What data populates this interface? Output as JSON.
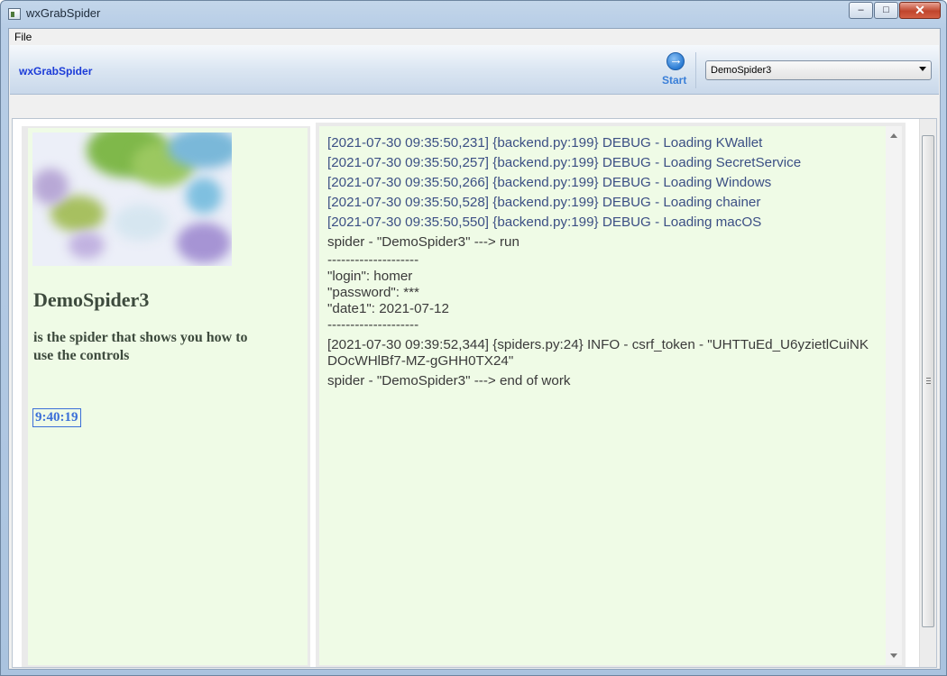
{
  "window": {
    "title": "wxGrabSpider"
  },
  "menu": {
    "file": "File"
  },
  "toolbar": {
    "brand": "wxGrabSpider",
    "start_label": "Start",
    "spider_selected": "DemoSpider3"
  },
  "spider": {
    "name": "DemoSpider3",
    "description": "is the spider that shows you how to use the controls",
    "clock": "9:40:19"
  },
  "log": {
    "lines": [
      "[2021-07-30 09:35:50,231] {backend.py:199} DEBUG - Loading KWallet",
      "[2021-07-30 09:35:50,257] {backend.py:199} DEBUG - Loading SecretService",
      "[2021-07-30 09:35:50,266] {backend.py:199} DEBUG - Loading Windows",
      "[2021-07-30 09:35:50,528] {backend.py:199} DEBUG - Loading chainer",
      "[2021-07-30 09:35:50,550] {backend.py:199} DEBUG - Loading macOS",
      "spider - \"DemoSpider3\" ---> run",
      "--------------------",
      "\"login\": homer",
      "\"password\": ***",
      "\"date1\": 2021-07-12",
      "--------------------",
      "[2021-07-30 09:39:52,344] {spiders.py:24} INFO - csrf_token - \"UHTTuEd_U6yzietlCuiNKDOcWHlBf7-MZ-gGHH0TX24\"",
      "spider - \"DemoSpider3\" ---> end of work"
    ]
  },
  "icons": {
    "start": "arrow-right-circle-icon",
    "dropdown": "chevron-down-icon",
    "app": "window-app-icon"
  },
  "colors": {
    "brand": "#1b3bd8",
    "log_debug": "#3b4f84",
    "panel_bg": "#effbe6",
    "clock": "#3b6fd8"
  }
}
